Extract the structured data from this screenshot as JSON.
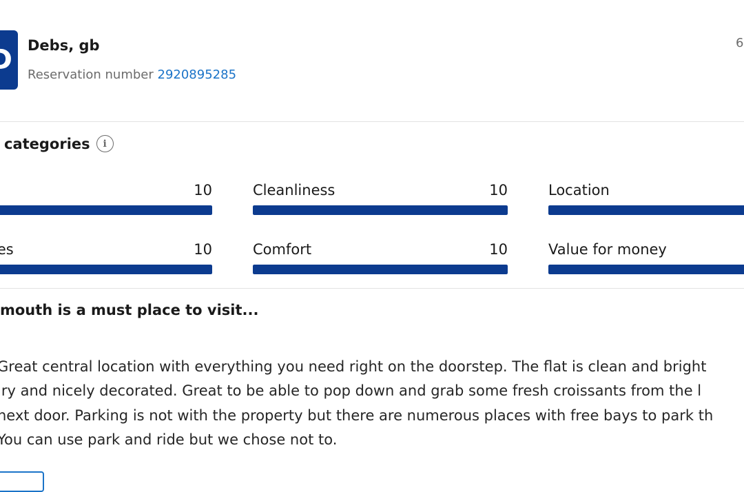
{
  "guest": {
    "avatar_initial": "D",
    "name": "Debs, gb",
    "reservation_label": "Reservation number",
    "reservation_number": "2920895285",
    "date_stub": "6"
  },
  "categories": {
    "title": "categories",
    "items": [
      {
        "label": "",
        "score": "10",
        "fraction": 1.0
      },
      {
        "label": "Cleanliness",
        "score": "10",
        "fraction": 1.0
      },
      {
        "label": "Location",
        "score": "",
        "fraction": 1.0
      },
      {
        "label": "ies",
        "score": "10",
        "fraction": 1.0
      },
      {
        "label": "Comfort",
        "score": "10",
        "fraction": 1.0
      },
      {
        "label": "Value for money",
        "score": "",
        "fraction": 1.0
      }
    ]
  },
  "review": {
    "title": "mouth is a must place to visit...",
    "lines": [
      "Great central location with everything you need right on the doorstep. The flat is clean and bright",
      "iry and nicely decorated. Great to be able to pop down and grab some fresh croissants from the l",
      "next door. Parking is not with the property but there are numerous places with free bays to park th",
      "You can use park and ride but we chose not to."
    ]
  },
  "colors": {
    "bar": "#0c3b8f",
    "link": "#1a73c8",
    "muted": "#6b6b6b"
  }
}
